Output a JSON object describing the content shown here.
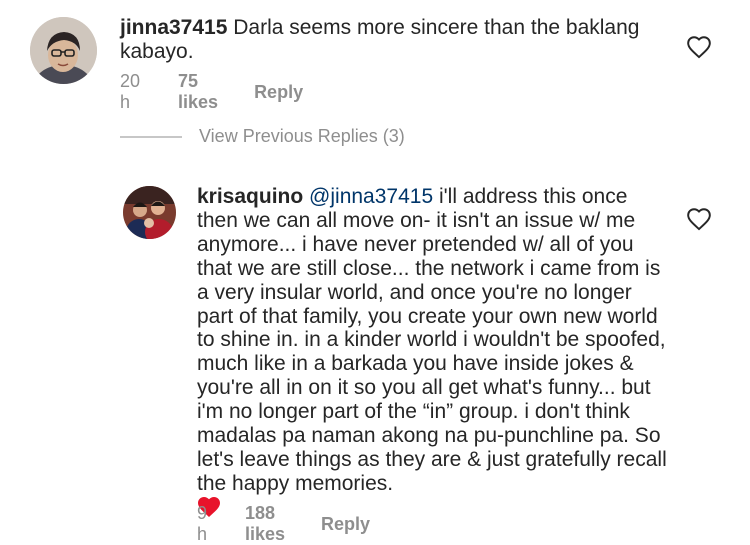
{
  "comments": [
    {
      "username": "jinna37415",
      "text": " Darla seems more sincere than the baklang kabayo.",
      "time": "20 h",
      "likes": "75 likes",
      "reply_label": "Reply"
    },
    {
      "username": "krisaquino",
      "mention": "@jinna37415",
      "text": " i'll address this once then we can all move on- it isn't an issue w/ me anymore... i have never pretended w/ all of you that we are still close... the network i came from is a very insular world, and once you're no longer part of that family, you create your own new world to shine in. in a kinder world i wouldn't be spoofed, much like in a barkada you have inside jokes & you're all in on it so you all get what's funny... but i'm no longer part of the “in” group. i don't think madalas pa naman akong na pu-punchline pa. So let's leave things as they are & just gratefully recall the happy memories.",
      "emoji": "red-heart",
      "time": "9 h",
      "likes": "188 likes",
      "reply_label": "Reply"
    }
  ],
  "view_previous": "View Previous Replies (3)",
  "icons": {
    "like": "heart-outline-icon",
    "emoji": "red-heart-emoji"
  },
  "colors": {
    "text": "#262626",
    "meta": "#8e8e8e",
    "mention": "#003569",
    "heart": "#e8132b"
  }
}
